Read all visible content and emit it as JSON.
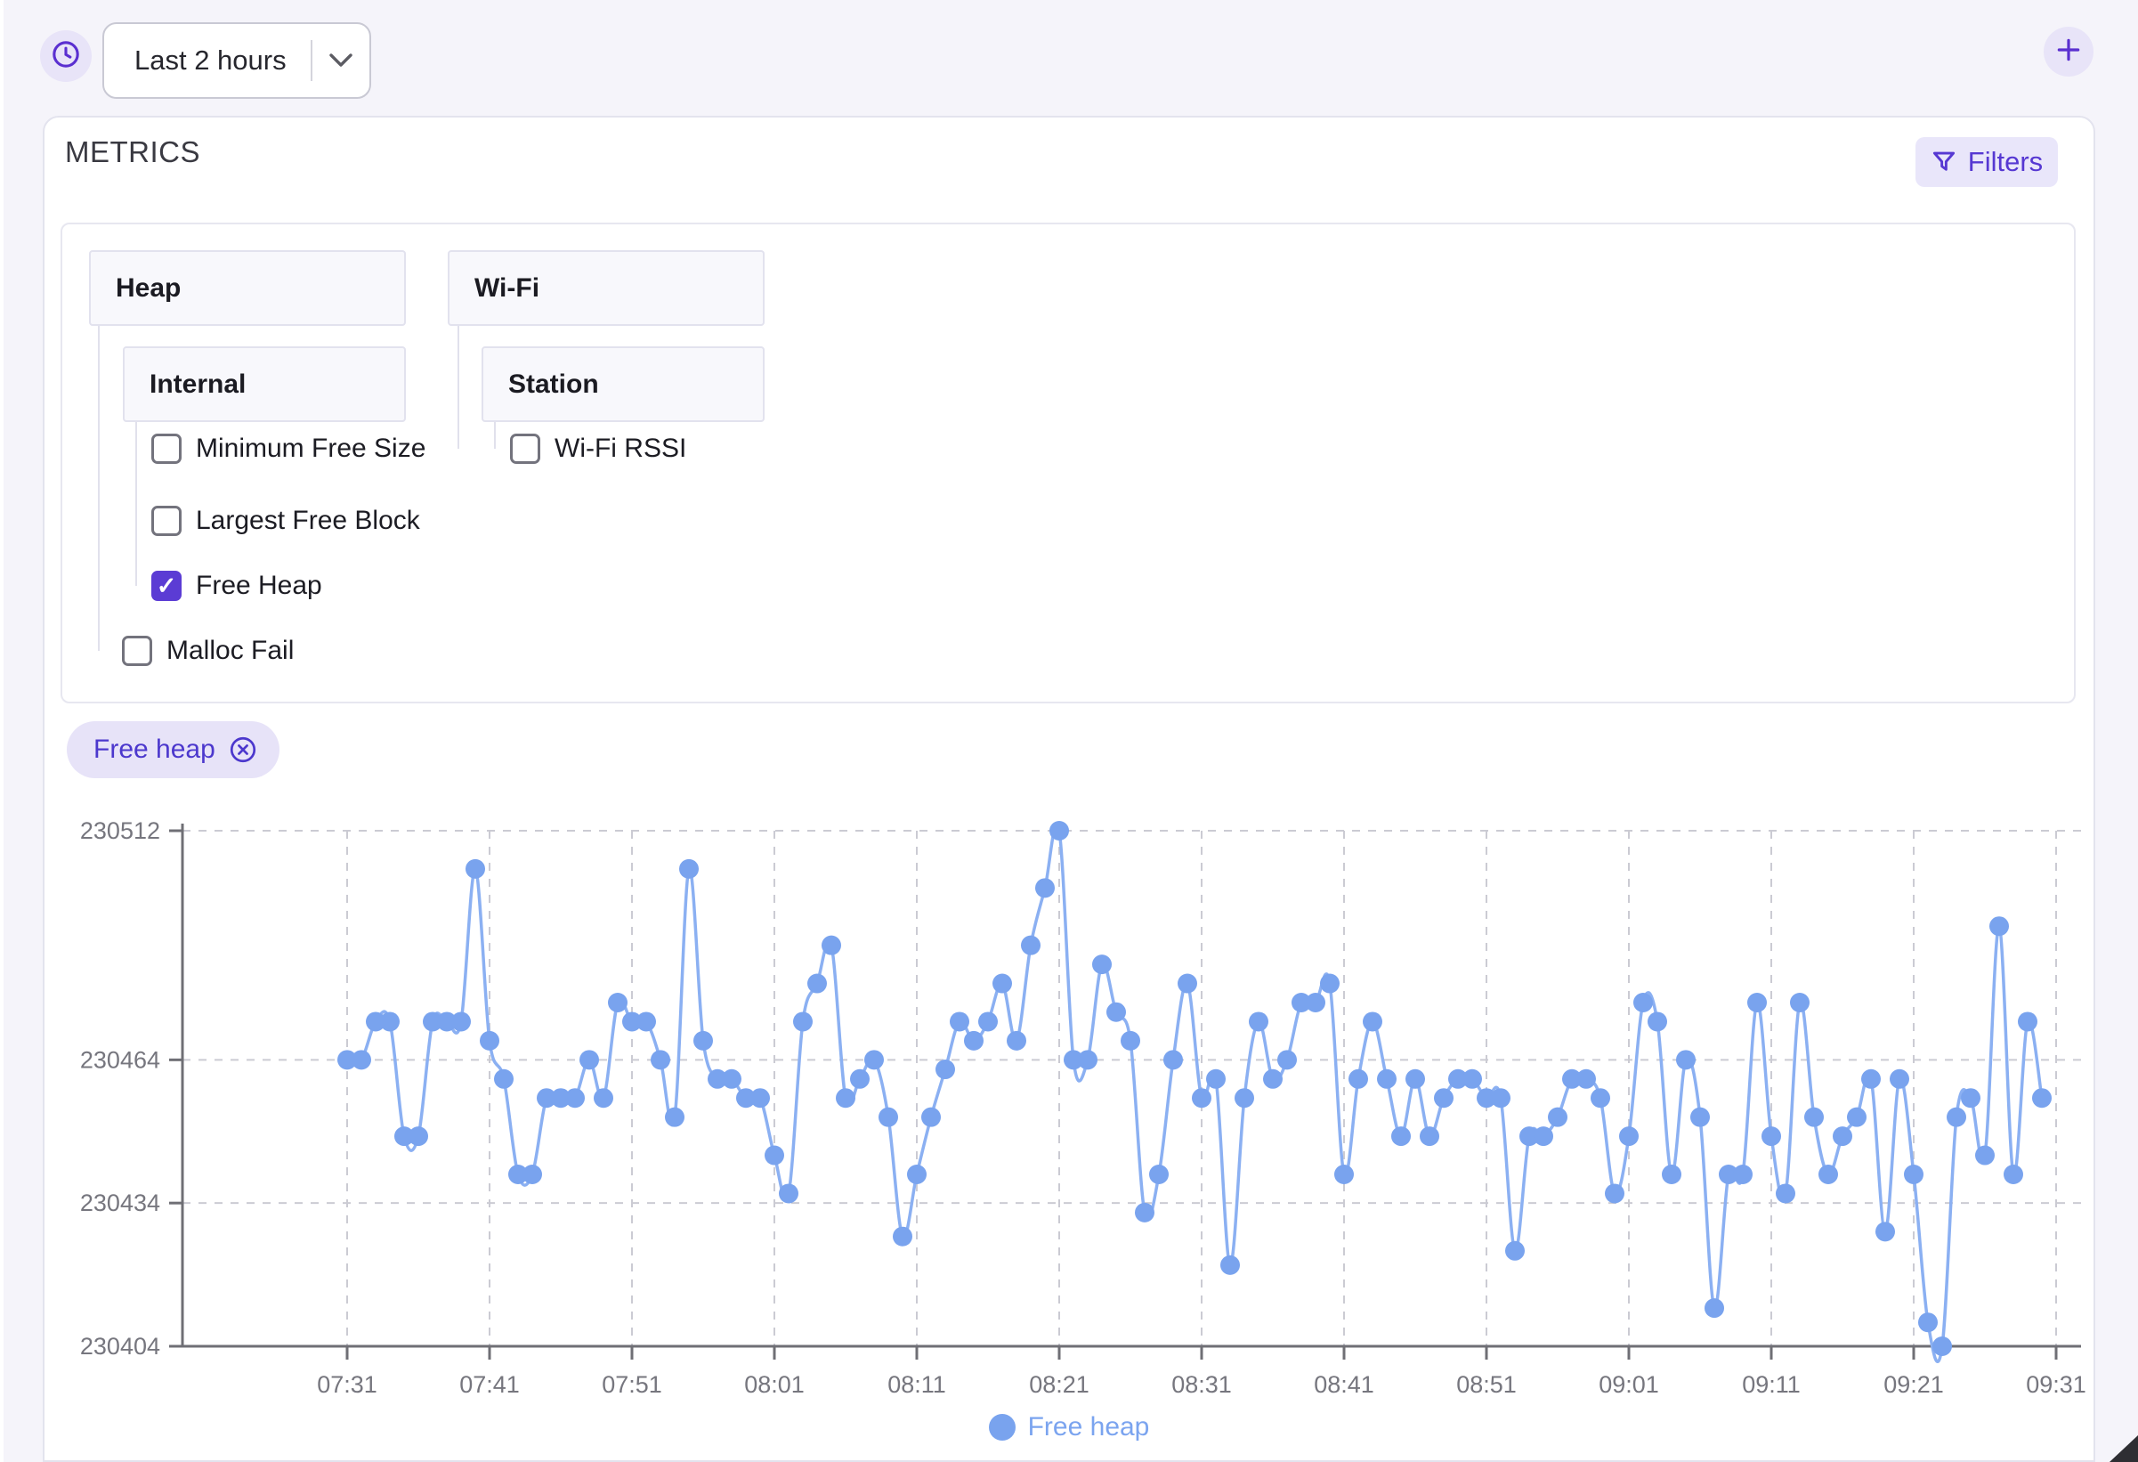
{
  "toolbar": {
    "time_range": "Last 2 hours"
  },
  "metrics_card": {
    "title": "METRICS",
    "filters_label": "Filters",
    "tree": {
      "groups": [
        {
          "label": "Heap"
        },
        {
          "label": "Wi-Fi"
        }
      ],
      "subgroups": [
        {
          "label": "Internal"
        },
        {
          "label": "Station"
        }
      ],
      "checkboxes": [
        {
          "label": "Minimum Free Size",
          "checked": false
        },
        {
          "label": "Largest Free Block",
          "checked": false
        },
        {
          "label": "Free Heap",
          "checked": true
        },
        {
          "label": "Malloc Fail",
          "checked": false
        },
        {
          "label": "Wi-Fi RSSI",
          "checked": false
        }
      ]
    },
    "chip": {
      "label": "Free heap"
    }
  },
  "chart_data": {
    "type": "line",
    "title": "",
    "xlabel": "",
    "ylabel": "",
    "x_start": "07:31",
    "x_interval_minutes": 1,
    "x_ticks": [
      "07:31",
      "07:41",
      "07:51",
      "08:01",
      "08:11",
      "08:21",
      "08:31",
      "08:41",
      "08:51",
      "09:01",
      "09:11",
      "09:21",
      "09:31"
    ],
    "y_ticks": [
      230512,
      230464,
      230434,
      230404
    ],
    "ylim": [
      230404,
      230512
    ],
    "grid": "dashed",
    "legend": {
      "position": "bottom",
      "label": "Free heap"
    },
    "series": [
      {
        "name": "Free heap",
        "values": [
          230464,
          230464,
          230472,
          230472,
          230448,
          230448,
          230472,
          230472,
          230472,
          230504,
          230468,
          230460,
          230440,
          230440,
          230456,
          230456,
          230456,
          230464,
          230456,
          230476,
          230472,
          230472,
          230464,
          230452,
          230504,
          230468,
          230460,
          230460,
          230456,
          230456,
          230444,
          230436,
          230472,
          230480,
          230488,
          230456,
          230460,
          230464,
          230452,
          230427,
          230440,
          230452,
          230462,
          230472,
          230468,
          230472,
          230480,
          230468,
          230488,
          230500,
          230512,
          230464,
          230464,
          230484,
          230474,
          230468,
          230432,
          230440,
          230464,
          230480,
          230456,
          230460,
          230421,
          230456,
          230472,
          230460,
          230464,
          230476,
          230476,
          230480,
          230440,
          230460,
          230472,
          230460,
          230448,
          230460,
          230448,
          230456,
          230460,
          230460,
          230456,
          230456,
          230424,
          230448,
          230448,
          230452,
          230460,
          230460,
          230456,
          230436,
          230448,
          230476,
          230472,
          230440,
          230464,
          230452,
          230412,
          230440,
          230440,
          230476,
          230448,
          230436,
          230476,
          230452,
          230440,
          230448,
          230452,
          230460,
          230428,
          230460,
          230440,
          230409,
          230404,
          230452,
          230456,
          230444,
          230492,
          230440,
          230472,
          230456
        ]
      }
    ]
  },
  "colors": {
    "accent": "#5638d2",
    "checkbox_checked": "#5b3cd4",
    "series_point": "#79a3ee",
    "series_line": "#8bb0f2",
    "legend_text": "#7ba4ef",
    "axis": "#6f6f75",
    "grid": "#cbcbd3",
    "tick_text": "#76767e",
    "page_bg": "#f5f4fa",
    "chip_bg": "#e7e3f8"
  }
}
